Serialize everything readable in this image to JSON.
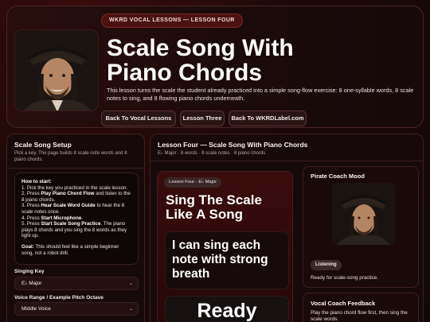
{
  "hero": {
    "badge": "WKRD VOCAL LESSONS — LESSON FOUR",
    "title": "Scale Song With Piano Chords",
    "description": "This lesson turns the scale the student already practiced into a simple song-flow exercise: 8 one-syllable words, 8 scale notes to sing, and 8 flowing piano chords underneath.",
    "buttons": [
      "Back To Vocal Lessons",
      "Lesson Three",
      "Back To WKRDLabel.com"
    ]
  },
  "setup": {
    "title": "Scale Song Setup",
    "subtitle": "Pick a key. The page builds 8 scale-note words and 8 piano chords.",
    "howto": {
      "heading": "How to start:",
      "step1": "1. Pick the key you practiced in the scale lesson.",
      "step2_pre": "2. Press ",
      "step2_bold": "Play Piano Chord Flow",
      "step2_post": " and listen to the 8 piano chords.",
      "step3_pre": "3. Press ",
      "step3_bold": "Hear Scale Word Guide",
      "step3_post": " to hear the 8 scale notes once.",
      "step4_pre": "4. Press ",
      "step4_bold": "Start Microphone",
      "step4_post": ".",
      "step5_pre": "5. Press ",
      "step5_bold": "Start Scale Song Practice",
      "step5_post": ". The piano plays 8 chords and you sing the 8 words as they light up.",
      "goal_label": "Goal:",
      "goal_text": " This should feel like a simple beginner song, not a robot drill."
    },
    "key_label": "Singing Key",
    "key_value": "E♭ Major",
    "range_label": "Voice Range / Example Pitch Octave",
    "range_value": "Middle Voice"
  },
  "lesson": {
    "title": "Lesson Four — Scale Song With Piano Chords",
    "subtitle": "E♭ Major · 8 words · 8 scale notes · 8 piano chords",
    "stage_tag": "Lesson Four · E♭ Major",
    "stage_title": "Sing The Scale Like A Song",
    "current_words": "I can sing each note with strong breath",
    "status": "Ready"
  },
  "coach": {
    "mood_title": "Pirate Coach Mood",
    "mood_badge": "Listening",
    "mood_text": "Ready for scale-song practice.",
    "feedback_title": "Vocal Coach Feedback",
    "feedback_text": "Play the piano chord flow first, then sing the scale words."
  },
  "icons": {
    "select_chevron": "chevron-down-icon"
  },
  "colors": {
    "accent": "#7a2828",
    "background": "#120707"
  }
}
